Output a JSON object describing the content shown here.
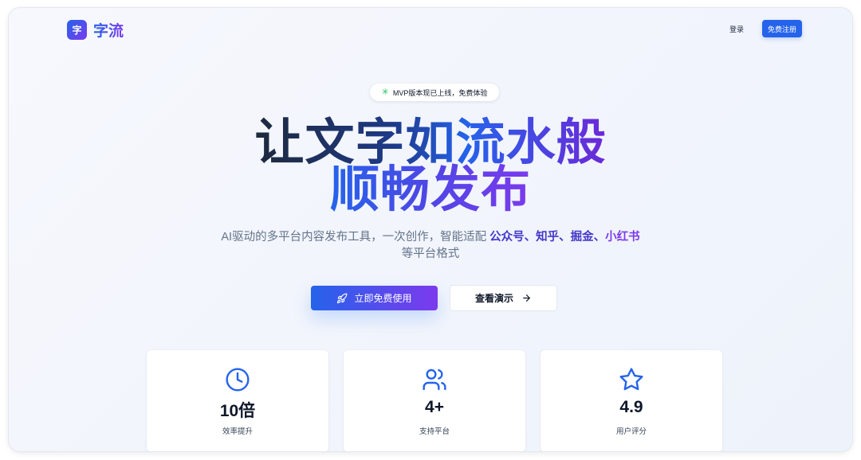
{
  "header": {
    "logo_mark": "字",
    "logo_text": "字流",
    "login_label": "登录",
    "signup_label": "免费注册"
  },
  "badge": {
    "icon": "sparkle-icon",
    "text": "MVP版本现已上线，免费体验"
  },
  "hero": {
    "title_line1": "让文字如流水般",
    "title_line2": "顺畅发布",
    "subtitle_prefix": "AI驱动的多平台内容发布工具，一次创作，智能适配",
    "platforms": [
      "公众号",
      "知乎",
      "掘金",
      "小红书"
    ],
    "platform_separator": "、",
    "subtitle_suffix": "等平台格式"
  },
  "cta": {
    "primary_label": "立即免费使用",
    "primary_icon": "rocket-icon",
    "secondary_label": "查看演示",
    "secondary_icon": "arrow-right-icon"
  },
  "stats": [
    {
      "icon": "clock-icon",
      "value": "10倍",
      "label": "效率提升"
    },
    {
      "icon": "users-icon",
      "value": "4+",
      "label": "支持平台"
    },
    {
      "icon": "star-icon",
      "value": "4.9",
      "label": "用户评分"
    }
  ],
  "colors": {
    "primary": "#2563eb",
    "accent": "#7c3aed",
    "badge_icon": "#22c55e"
  }
}
